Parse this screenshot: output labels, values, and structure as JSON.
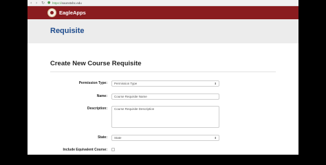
{
  "browser": {
    "url_protocol": "https://",
    "url_host": "eaonstvbc.edu"
  },
  "app": {
    "brand": "EagleApps"
  },
  "page": {
    "title": "Requisite"
  },
  "form": {
    "heading": "Create New Course Requisite",
    "permission_type": {
      "label": "Permission Type:",
      "value": "Permission Type"
    },
    "name": {
      "label": "Name:",
      "placeholder": "Course Requisite Name"
    },
    "description": {
      "label": "Description:",
      "placeholder": "Course Requisite Description"
    },
    "state": {
      "label": "State:",
      "value": "State"
    },
    "include_equivalent": {
      "label": "Include Equivalent Course:",
      "checked": false
    }
  },
  "icons": {
    "back": "back-arrow-icon",
    "forward": "forward-arrow-icon",
    "reload": "reload-icon",
    "lock": "lock-icon",
    "dropdown": "chevron-down-icon"
  }
}
